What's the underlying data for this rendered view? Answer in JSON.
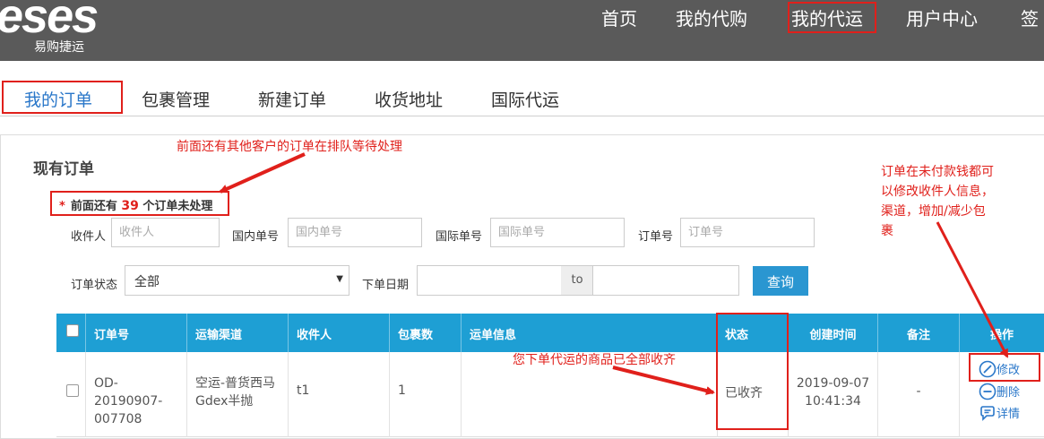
{
  "header": {
    "logo_text": "eses",
    "logo_subtitle": "易购捷运",
    "nav": [
      {
        "label": "首页"
      },
      {
        "label": "我的代购"
      },
      {
        "label": "我的代运"
      },
      {
        "label": "用户中心"
      },
      {
        "label": "签"
      }
    ]
  },
  "tabs": [
    {
      "label": "我的订单"
    },
    {
      "label": "包裹管理"
    },
    {
      "label": "新建订单"
    },
    {
      "label": "收货地址"
    },
    {
      "label": "国际代运"
    }
  ],
  "section_title": "现有订单",
  "pending": {
    "star": "*",
    "prefix": "前面还有",
    "count": "39",
    "suffix": "个订单未处理"
  },
  "filters": {
    "recipient": {
      "label": "收件人",
      "placeholder": "收件人"
    },
    "domestic_no": {
      "label": "国内单号",
      "placeholder": "国内单号"
    },
    "intl_no": {
      "label": "国际单号",
      "placeholder": "国际单号"
    },
    "order_no": {
      "label": "订单号",
      "placeholder": "订单号"
    },
    "status": {
      "label": "订单状态",
      "value": "全部"
    },
    "date": {
      "label": "下单日期",
      "separator": "to"
    },
    "query_button": "查询"
  },
  "table": {
    "headers": [
      "订单号",
      "运输渠道",
      "收件人",
      "包裹数",
      "运单信息",
      "状态",
      "创建时间",
      "备注",
      "操作"
    ],
    "rows": [
      {
        "order_no_line1": "OD-20190907-",
        "order_no_line2": "007708",
        "channel_line1": "空运-普货西马",
        "channel_line2": "Gdex半抛",
        "recipient": "t1",
        "packages": "1",
        "waybill": "",
        "status": "已收齐",
        "created_date": "2019-09-07",
        "created_time": "10:41:34",
        "remark": "-",
        "actions": {
          "edit": "修改",
          "delete": "删除",
          "detail": "详情"
        }
      }
    ]
  },
  "annotations": {
    "queue_note": "前面还有其他客户的订单在排队等待处理",
    "edit_note": [
      "订单在未付款钱都可",
      "以修改收件人信息，",
      "渠道，增加/减少包",
      "裹"
    ],
    "status_note": "您下单代运的商品已全部收齐"
  },
  "colors": {
    "header_bg": "#5a5a5a",
    "table_header": "#1e9fd4",
    "accent": "#2a77c9",
    "annotation_red": "#e0201b",
    "button": "#2a96d1"
  }
}
